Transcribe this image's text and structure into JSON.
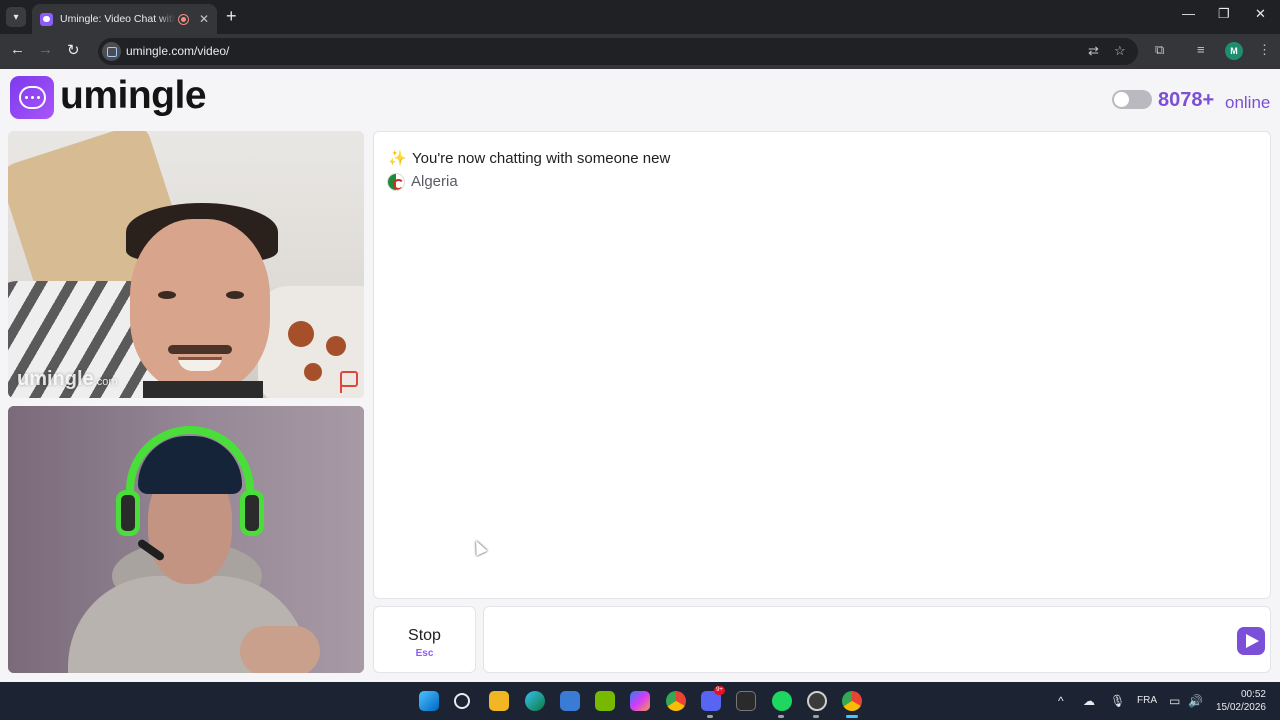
{
  "browser": {
    "tab_title": "Umingle: Video Chat with Strangers",
    "url": "umingle.com/video/",
    "profile_initial": "M"
  },
  "header": {
    "logo_text": "umingle",
    "online_count": "8078+",
    "online_label": "online"
  },
  "videos": {
    "watermark_brand": "umingle",
    "watermark_suffix": ".com"
  },
  "chat": {
    "status_message": "You're now chatting with someone new",
    "country": "Algeria"
  },
  "controls": {
    "stop_label": "Stop",
    "stop_shortcut": "Esc",
    "message_value": ""
  },
  "taskbar": {
    "notification_badge": "9+",
    "language": "FRA",
    "time": "00:52",
    "date": "15/02/2026"
  },
  "colors": {
    "brand_purple": "#7b4fd6",
    "chrome_dark": "#202124",
    "page_background": "#f5f5f7"
  }
}
